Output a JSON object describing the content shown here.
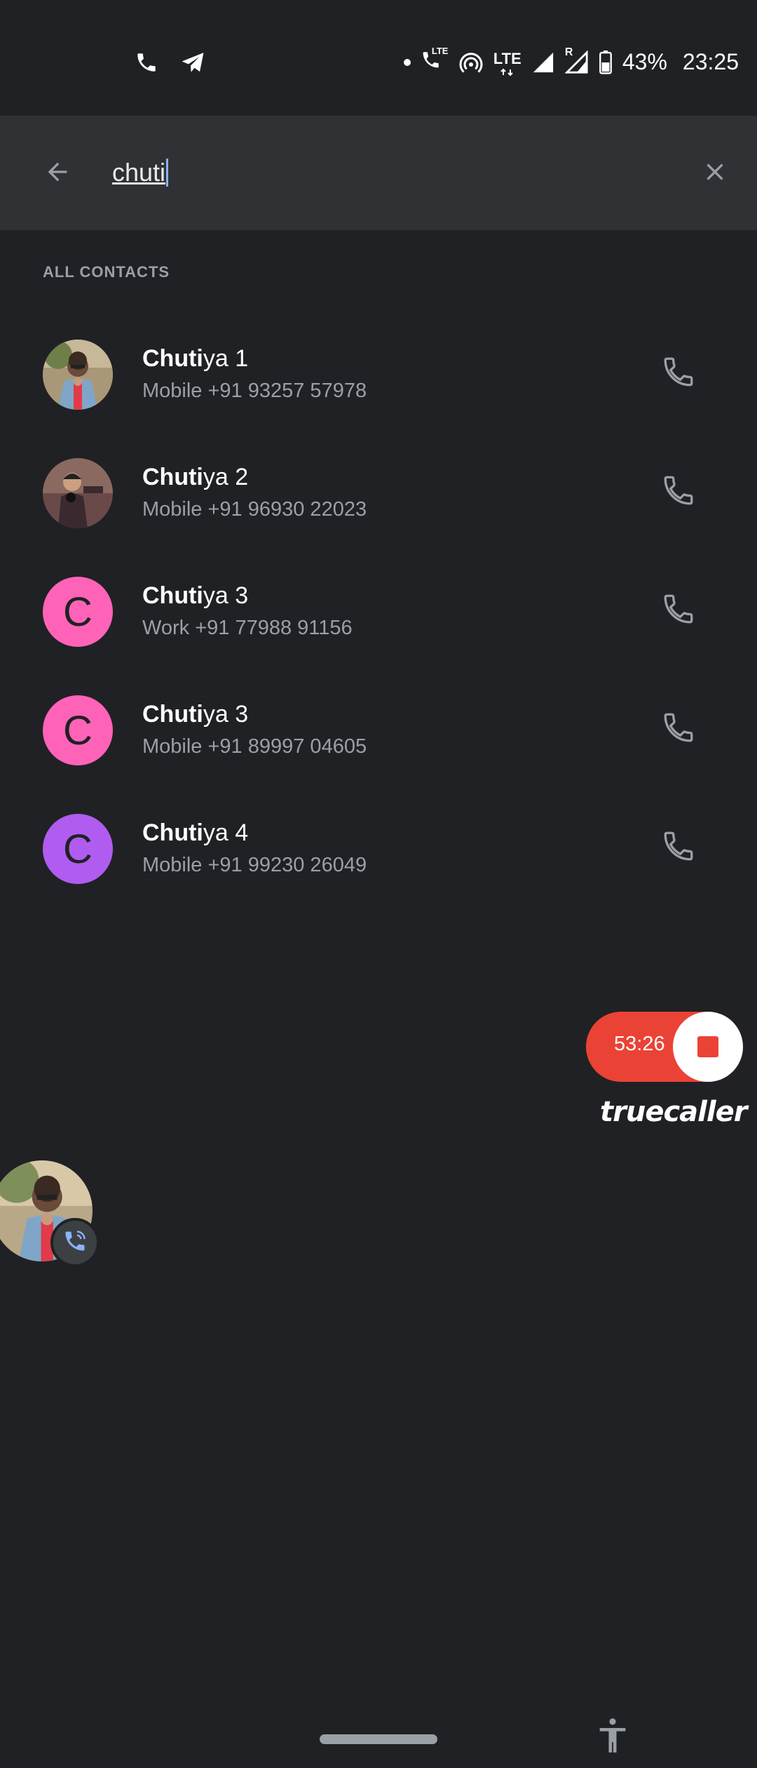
{
  "status_bar": {
    "battery": "43%",
    "time": "23:25",
    "left_icons": [
      "phone-icon",
      "telegram-icon"
    ],
    "right_icons": [
      "notification-dot-icon",
      "volte-call-icon",
      "hotspot-icon",
      "lte-data-icon",
      "signal-icon",
      "roaming-signal-icon",
      "battery-icon"
    ],
    "volte_label": "LTE",
    "lte_label": "LTE",
    "roaming_label": "R"
  },
  "search": {
    "query": "chuti",
    "back_icon": "arrow-back-icon",
    "clear_icon": "close-icon"
  },
  "section_header": "ALL CONTACTS",
  "contacts": [
    {
      "name_match": "Chuti",
      "name_rest": "ya 1",
      "detail": "Mobile +91 93257 57978",
      "avatar": "photo",
      "avatar_color": "#8a6b4a"
    },
    {
      "name_match": "Chuti",
      "name_rest": "ya 2",
      "detail": "Mobile +91 96930 22023",
      "avatar": "photo",
      "avatar_color": "#5a3a3a"
    },
    {
      "name_match": "Chuti",
      "name_rest": "ya 3",
      "detail": "Work +91 77988 91156",
      "avatar": "C",
      "avatar_color": "#ff63b8"
    },
    {
      "name_match": "Chuti",
      "name_rest": "ya 3",
      "detail": "Mobile +91 89997 04605",
      "avatar": "C",
      "avatar_color": "#ff63b8"
    },
    {
      "name_match": "Chuti",
      "name_rest": "ya 4",
      "detail": "Mobile +91 99230 26049",
      "avatar": "C",
      "avatar_color": "#b05cf0"
    }
  ],
  "recorder": {
    "time": "53:26",
    "brand": "truecaller",
    "accent": "#ea4335"
  },
  "colors": {
    "background": "#202124",
    "search_bar": "#303134",
    "text_primary": "#ffffff",
    "text_secondary": "#9aa0a6"
  }
}
